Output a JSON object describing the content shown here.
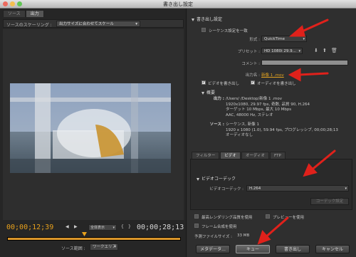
{
  "window": {
    "title": "書き出し設定"
  },
  "left": {
    "tabs": [
      "ソース",
      "出力"
    ],
    "scaling_label": "ソースのスケーリング :",
    "scaling_value": "出力サイズに合わせてスケール",
    "timecode_current": "00;00;12;39",
    "timecode_end": "00;00;28;13",
    "fit_value": "全体表示",
    "source_range_label": "ソース範囲 :",
    "source_range_value": "ワークエリア"
  },
  "export": {
    "section_title": "書き出し設定",
    "match_sequence_label": "シーケンス設定を一致",
    "format_label": "形式 :",
    "format_value": "QuickTime",
    "preset_label": "プリセット :",
    "preset_value": "HD 1080i 29.9...",
    "comment_label": "コメント :",
    "output_name_label": "出力名 :",
    "output_name_value": "新像 1 .mov",
    "export_video_label": "ビデオを書き出し",
    "export_audio_label": "オーディオを書き出し"
  },
  "summary": {
    "title": "概要",
    "output_label": "出力 :",
    "output_lines": [
      "/Users/       /Desktop/新像 1 .mov",
      "1920x1080, 29.97 fps, 奇数, 品質 90, H.264",
      "ターゲット 10 Mbps, 最大 10 Mbps",
      "AAC, 48000 Hz, ステレオ"
    ],
    "source_label": "ソース :",
    "source_lines": [
      "シーケンス, 新像 1",
      "1920 x 1080 (1.0), 59.94 fps, プログレッシブ, 00;00;28;13",
      "オーディオなし"
    ]
  },
  "lower_tabs": [
    "フィルター",
    "ビデオ",
    "オーディオ",
    "FTP"
  ],
  "video_codec": {
    "section_title": "ビデオコーデック",
    "codec_label": "ビデオコーデック :",
    "codec_value": "H.264",
    "codec_settings_label": "コーデック設定"
  },
  "options": {
    "max_render_quality": "最高レンダリング品質を使用",
    "use_previews": "プレビューを使用",
    "frame_blending": "フレーム合成を使用",
    "file_size_label": "予測ファイルサイズ :",
    "file_size_value": "33 MB"
  },
  "footer": {
    "metadata": "メタデータ...",
    "queue": "キュー",
    "export": "書き出し",
    "cancel": "キャンセル"
  },
  "colors": {
    "accent_orange": "#e2a220",
    "arrow_red": "#e0211b"
  }
}
